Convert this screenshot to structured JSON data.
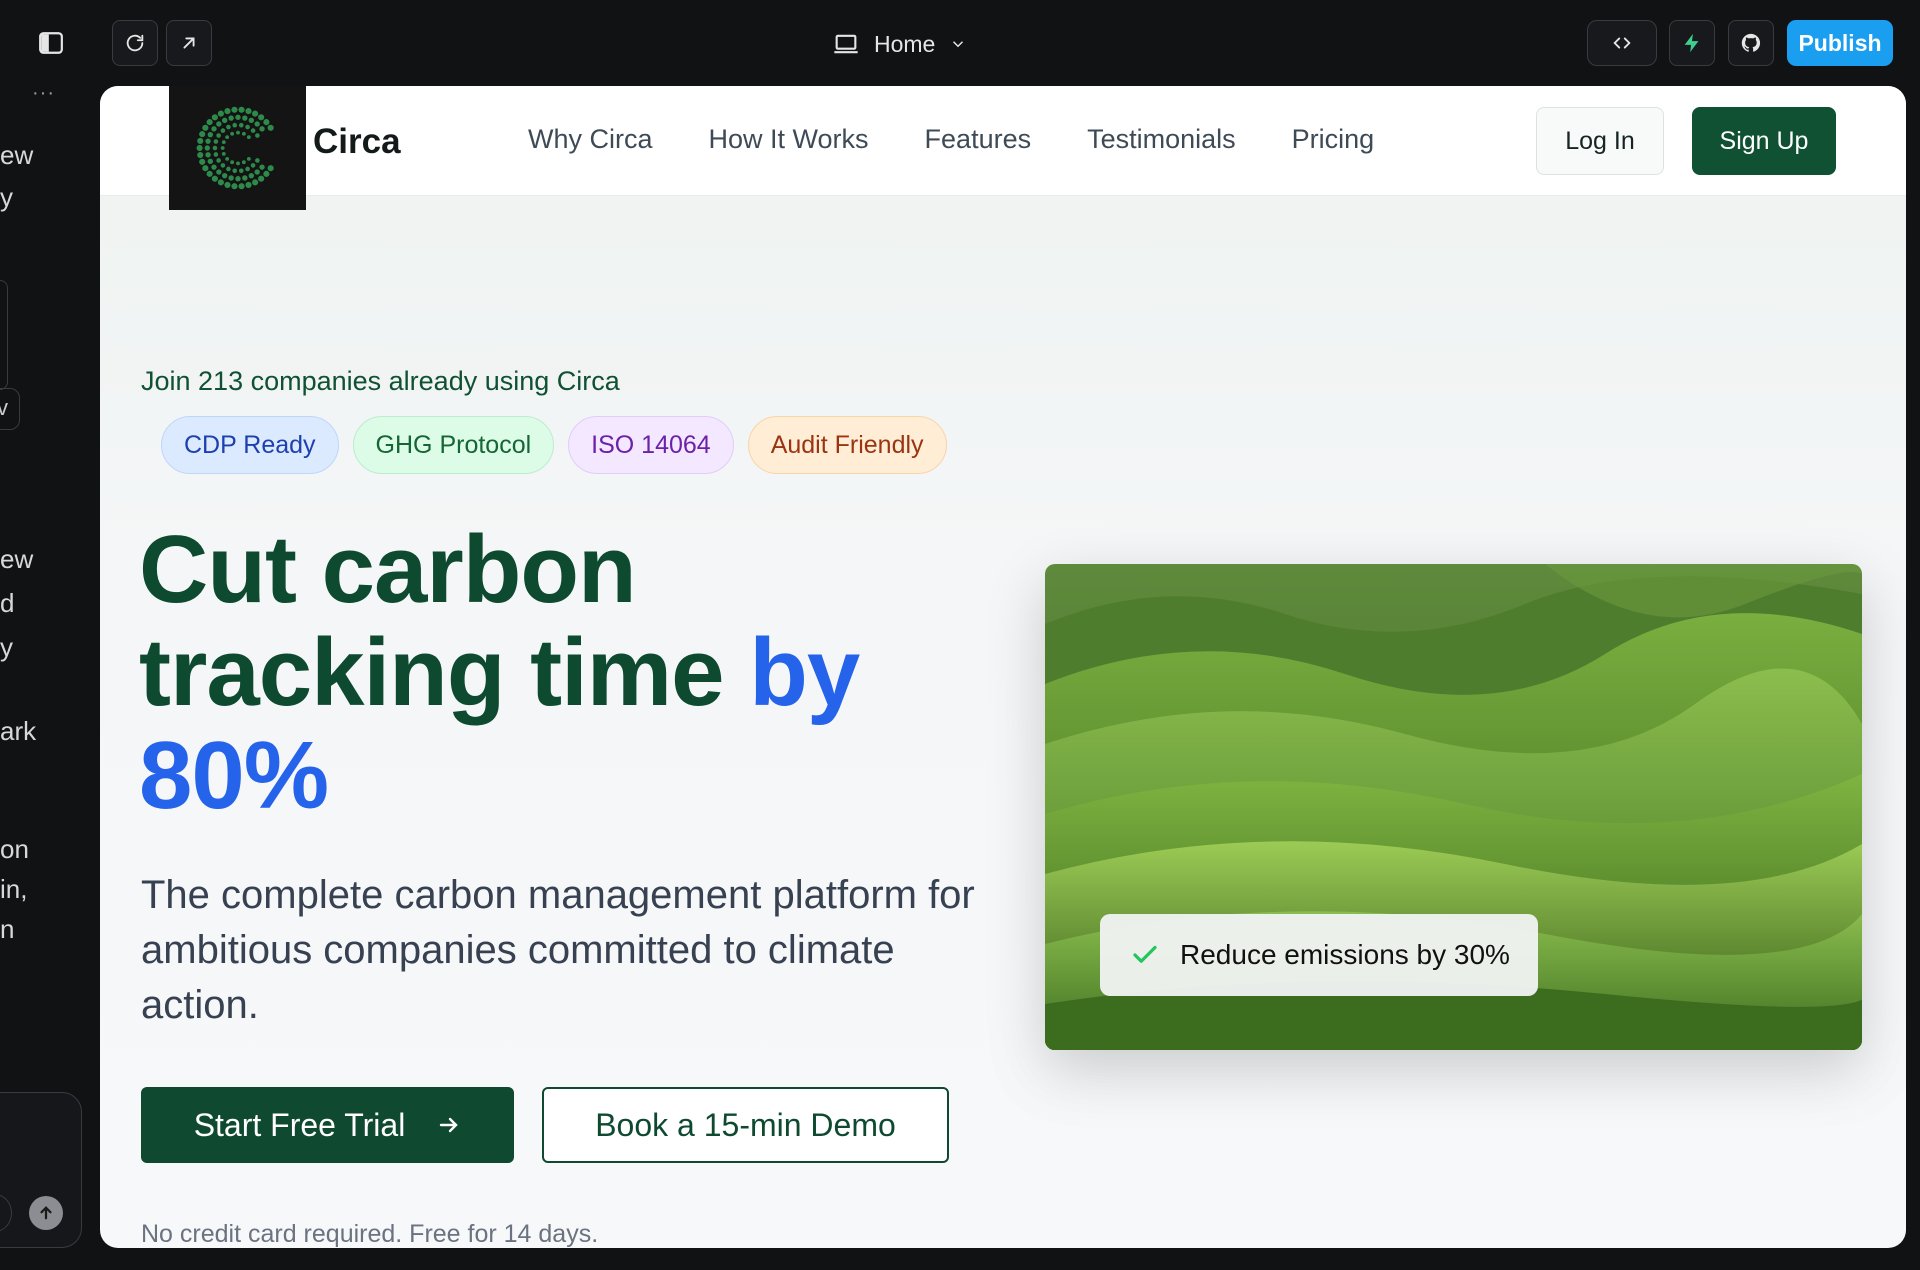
{
  "editor": {
    "device_label": "Home",
    "publish_label": "Publish",
    "dots": "···"
  },
  "sidebar_fragments": [
    "ew",
    "y",
    "ew",
    "d",
    "y",
    "ark",
    "on",
    "in,",
    "n"
  ],
  "sidebar_button_fragment": "v",
  "site": {
    "brand": "Circa",
    "nav": [
      "Why Circa",
      "How It Works",
      "Features",
      "Testimonials",
      "Pricing"
    ],
    "login_label": "Log In",
    "signup_label": "Sign Up"
  },
  "hero": {
    "eyebrow": "Join 213 companies already using Circa",
    "badges": [
      "CDP Ready",
      "GHG Protocol",
      "ISO 14064",
      "Audit Friendly"
    ],
    "headline_line1": "Cut carbon",
    "headline_line2": "tracking time ",
    "headline_highlight_inline": "by",
    "headline_highlight_line": "80%",
    "subtitle": "The complete carbon management platform for ambitious companies committed to climate action.",
    "cta_primary": "Start Free Trial",
    "cta_secondary": "Book a 15-min Demo",
    "fineprint": "No credit card required. Free for 14 days.",
    "image_toast": "Reduce emissions by 30%"
  },
  "colors": {
    "brand_green": "#0f4a30",
    "accent_blue": "#2563eb",
    "publish_blue": "#1a9ef0"
  }
}
